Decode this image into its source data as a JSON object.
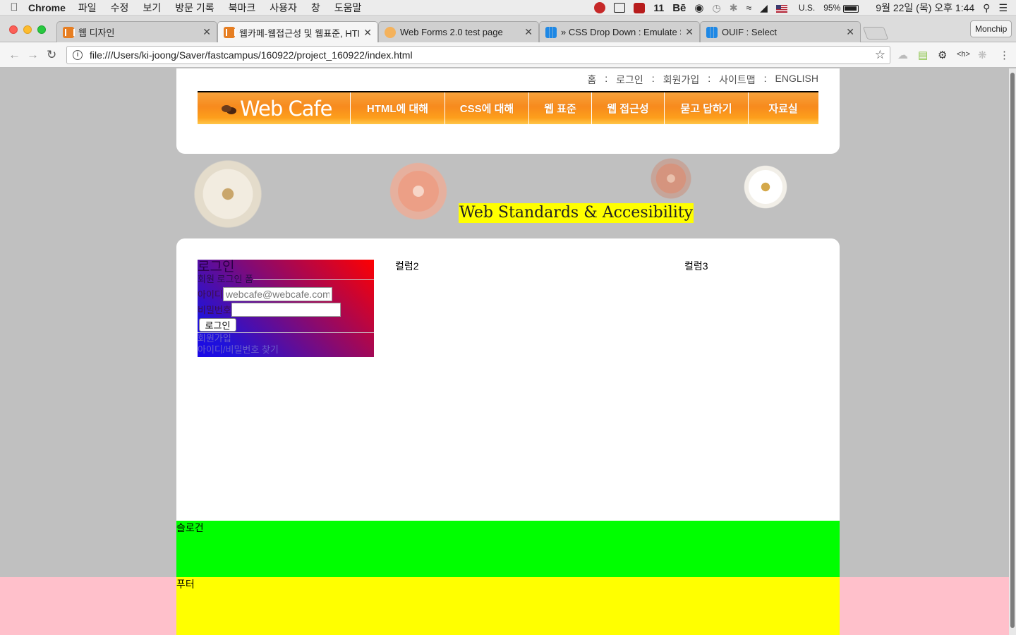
{
  "menubar": {
    "app": "Chrome",
    "items": [
      "파일",
      "수정",
      "보기",
      "방문 기록",
      "북마크",
      "사용자",
      "창",
      "도움말"
    ],
    "status": {
      "adobe_count": "11",
      "behance": "Bē",
      "input_source": "U.S.",
      "battery": "95%",
      "datetime": "9월 22일 (목) 오후 1:44"
    }
  },
  "tabs": [
    {
      "title": "웹 디자인",
      "favicon": "webcafe-icon"
    },
    {
      "title": "웹카페-웹접근성 및 웹표준, HTML5",
      "favicon": "webcafe-icon"
    },
    {
      "title": "Web Forms 2.0 test page",
      "favicon": "burger-icon"
    },
    {
      "title": "» CSS Drop Down : Emulate S",
      "favicon": "grid-icon"
    },
    {
      "title": "OUIF : Select",
      "favicon": "grid-icon"
    }
  ],
  "profile": "Monchip",
  "omnibox": {
    "url": "file:///Users/ki-joong/Saver/fastcampus/160922/project_160922/index.html"
  },
  "page": {
    "util_links": [
      "홈",
      "로그인",
      "회원가입",
      "사이트맵",
      "ENGLISH"
    ],
    "util_sep": ":",
    "logo_text": "Web Cafe",
    "gnb": [
      "HTML에 대해",
      "CSS에 대해",
      "웹 표준",
      "웹 접근성",
      "묻고 답하기",
      "자료실"
    ],
    "visual_title": "Web Standards & Accesibility",
    "login": {
      "title": "로그인",
      "legend": "회원 로그인 폼",
      "id_label": "아이디",
      "id_value": "webcafe@webcafe.com",
      "pw_label": "비밀번호",
      "pw_value": "",
      "submit": "로그인",
      "join": "회원가입",
      "find": "아이디/비밀번호 찾기"
    },
    "col2": "컬럼2",
    "col3": "컬럼3",
    "slogan": "슬로건",
    "footer": "푸터"
  },
  "colors": {
    "gnb_orange": "#f78a1d",
    "slogan_green": "#00ff00",
    "footer_yellow": "#ffff00",
    "footer_bg_pink": "#ffc0cb",
    "page_bg": "#c0c0c0",
    "highlight": "#ffff00"
  }
}
